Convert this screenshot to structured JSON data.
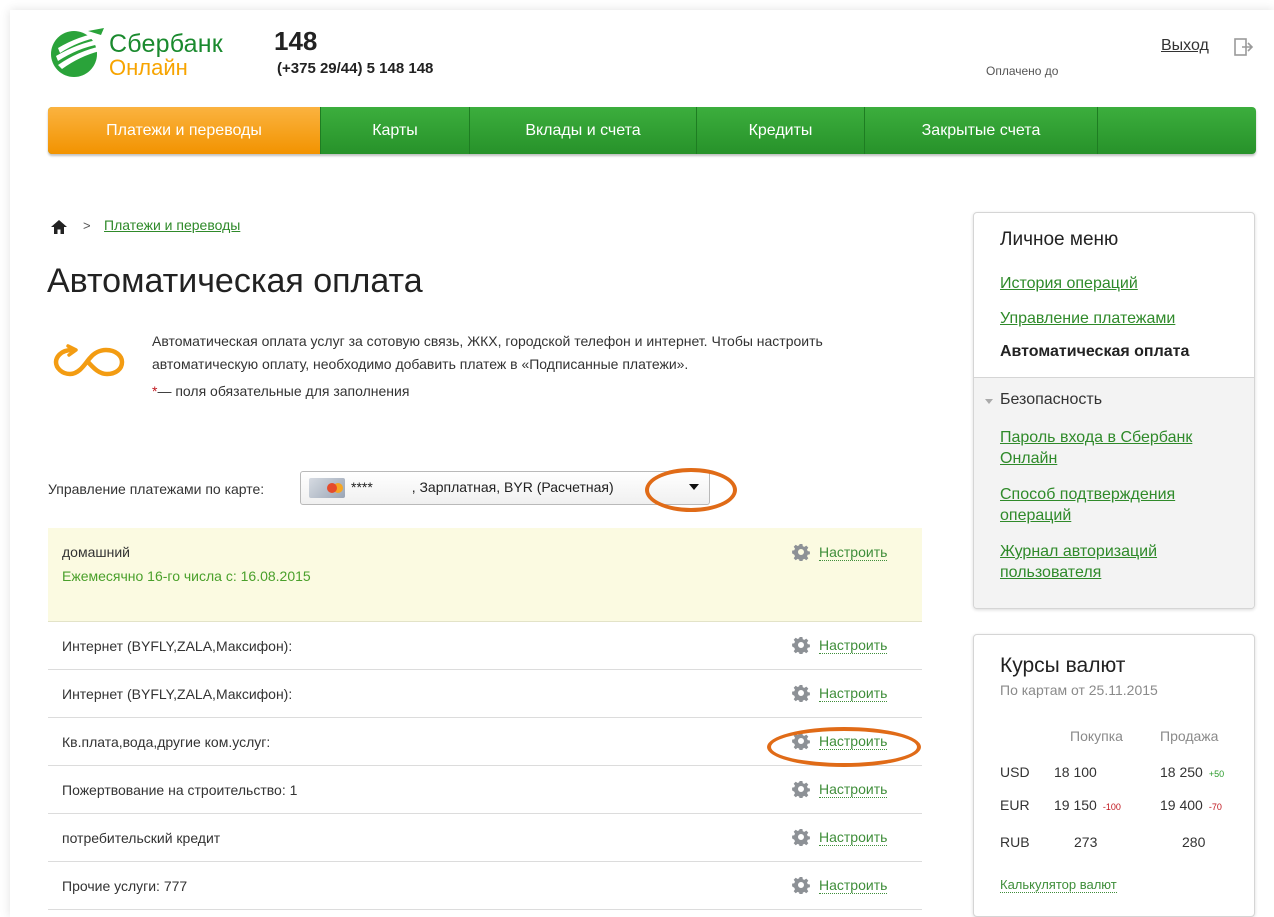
{
  "header": {
    "logo_line1": "Сбербанк",
    "logo_line2": "Онлайн",
    "phone_short": "148",
    "phone_full": "(+375 29/44) 5 148 148",
    "logout": "Выход",
    "paid_until": "Оплачено до"
  },
  "nav": {
    "tabs": [
      {
        "label": "Платежи и переводы",
        "active": true
      },
      {
        "label": "Карты"
      },
      {
        "label": "Вклады и счета"
      },
      {
        "label": "Кредиты"
      },
      {
        "label": "Закрытые счета"
      },
      {
        "label": ""
      }
    ]
  },
  "breadcrumb": {
    "link": "Платежи и переводы",
    "separator": ">"
  },
  "page": {
    "title": "Автоматическая оплата",
    "description": "Автоматическая оплата услуг за сотовую связь, ЖКХ, городской телефон и интернет. Чтобы настроить автоматическую оплату, необходимо добавить платеж в «Подписанные платежи».",
    "required_star": "*",
    "required_note": "— поля обязательные для заполнения"
  },
  "card_select": {
    "label": "Управление платежами по карте:",
    "value": "****          , Зарплатная, BYR (Расчетная)"
  },
  "payments": {
    "action_label": "Настроить",
    "items": [
      {
        "title": "домашний",
        "subtitle": "Ежемесячно 16-го числа с: 16.08.2015"
      },
      {
        "title": "Интернет (BYFLY,ZALA,Максифон):"
      },
      {
        "title": "Интернет (BYFLY,ZALA,Максифон):"
      },
      {
        "title": "Кв.плата,вода,другие ком.услуг:"
      },
      {
        "title": "Пожертвование на строительство: 1"
      },
      {
        "title": "потребительский кредит"
      },
      {
        "title": "Прочие услуги: 777"
      }
    ]
  },
  "personal_menu": {
    "title": "Личное меню",
    "links": [
      "История операций",
      "Управление платежами"
    ],
    "active": "Автоматическая оплата",
    "security_title": "Безопасность",
    "security_links": [
      "Пароль входа в Сбербанк Онлайн",
      "Способ подтверждения операций",
      "Журнал авторизаций пользователя"
    ]
  },
  "rates": {
    "title": "Курсы валют",
    "subtitle": "По картам от   25.11.2015",
    "buy_header": "Покупка",
    "sell_header": "Продажа",
    "rows": [
      {
        "currency": "USD",
        "buy": "18 100",
        "buy_change": "",
        "sell": "18 250",
        "sell_change": "+50"
      },
      {
        "currency": "EUR",
        "buy": "19 150",
        "buy_change": "-100",
        "sell": "19 400",
        "sell_change": "-70"
      },
      {
        "currency": "RUB",
        "buy": "273",
        "buy_change": "",
        "sell": "280",
        "sell_change": ""
      }
    ],
    "calculator": "Калькулятор валют"
  },
  "colors": {
    "brand_green": "#2f9a32",
    "nav_active_orange": "#f6a623",
    "highlight_ellipse": "#e06b17",
    "link_green": "#2f8a2a"
  }
}
